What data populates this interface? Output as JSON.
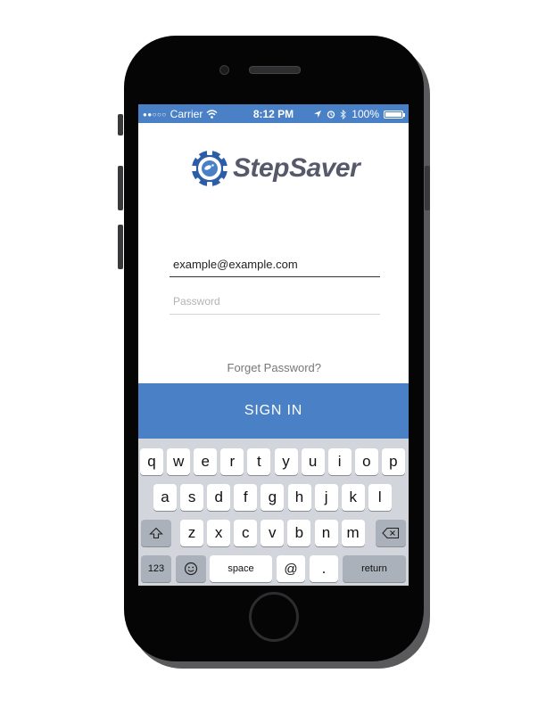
{
  "status_bar": {
    "signal": "●●○○○",
    "carrier": "Carrier",
    "time": "8:12 PM",
    "battery": "100%",
    "battery_level": 1.0,
    "icons": [
      "wifi-icon",
      "location-arrow-icon",
      "alarm-icon",
      "bluetooth-icon",
      "battery-icon"
    ]
  },
  "app": {
    "logo_text": "StepSaver",
    "brand_color": "#4a80c6"
  },
  "login": {
    "email_value": "example@example.com",
    "password_placeholder": "Password",
    "forgot_label": "Forget Password?",
    "signin_label": "SIGN IN"
  },
  "keyboard": {
    "row1": [
      "q",
      "w",
      "e",
      "r",
      "t",
      "y",
      "u",
      "i",
      "o",
      "p"
    ],
    "row2": [
      "a",
      "s",
      "d",
      "f",
      "g",
      "h",
      "j",
      "k",
      "l"
    ],
    "row3": [
      "z",
      "x",
      "c",
      "v",
      "b",
      "n",
      "m"
    ],
    "numbers_label": "123",
    "space_label": "space",
    "at_label": "@",
    "period_label": ".",
    "return_label": "return"
  }
}
